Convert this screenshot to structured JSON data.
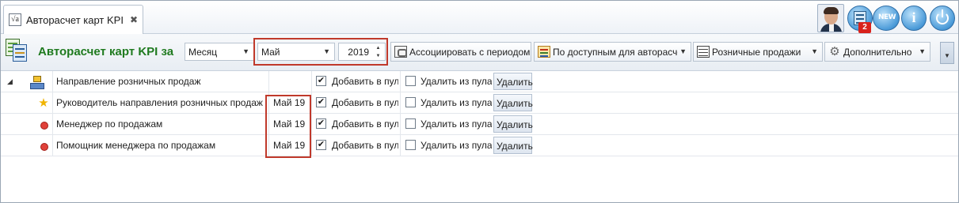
{
  "tab": {
    "icon": "function-sheet-icon",
    "icon_text": "√a",
    "title": "Авторасчет карт KPI",
    "close": "✖"
  },
  "top_right": {
    "avatar": "user-avatar",
    "calc_badge": "2",
    "new_label": "NEW",
    "info_label": "i"
  },
  "toolbar": {
    "title": "Авторасчет карт KPI за",
    "period_type": "Месяц",
    "month": "Май",
    "year": "2019",
    "associate_label": "Ассоциировать с периодом",
    "available_label": "По доступным для авторасче",
    "retail_label": "Розничные продажи",
    "more_label": "Дополнительно",
    "arrow": "▼",
    "spin_up": "▲",
    "spin_down": "▼",
    "overflow": "▼"
  },
  "grid": {
    "expander": "◢",
    "rows": [
      {
        "icon": "org-structure-icon",
        "name": "Направление розничных продаж",
        "period": "",
        "add_checked": "✔",
        "add_label": "Добавить в пул",
        "remove_checked": "",
        "remove_label": "Удалить из пула",
        "delete_label": "Удалить"
      },
      {
        "icon": "star-icon",
        "name": "Руководитель направления розничных продаж",
        "period": "Май 19",
        "add_checked": "✔",
        "add_label": "Добавить в пул",
        "remove_checked": "",
        "remove_label": "Удалить из пула",
        "delete_label": "Удалить"
      },
      {
        "icon": "red-dot-icon",
        "name": "Менеджер по продажам",
        "period": "Май 19",
        "add_checked": "✔",
        "add_label": "Добавить в пул",
        "remove_checked": "",
        "remove_label": "Удалить из пула",
        "delete_label": "Удалить"
      },
      {
        "icon": "red-dot-icon",
        "name": "Помощник менеджера по продажам",
        "period": "Май 19",
        "add_checked": "✔",
        "add_label": "Добавить в пул",
        "remove_checked": "",
        "remove_label": "Удалить из пула",
        "delete_label": "Удалить"
      }
    ]
  },
  "colors": {
    "title_green": "#1f7a1f",
    "highlight_red": "#c0392b",
    "accent_blue": "#4a9ad8"
  }
}
